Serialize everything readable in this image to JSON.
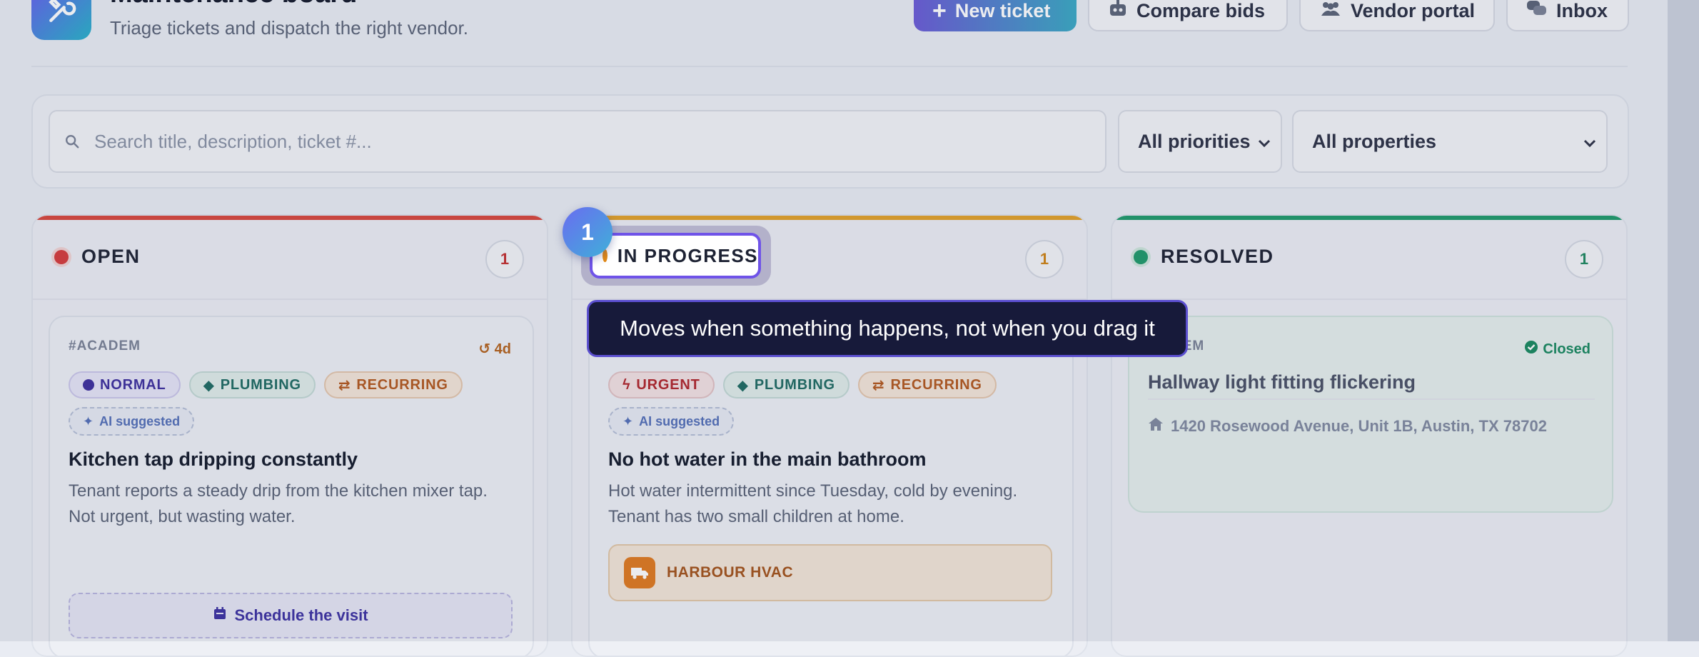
{
  "header": {
    "title": "Maintenance board",
    "subtitle": "Triage tickets and dispatch the right vendor.",
    "buttons": {
      "new_ticket": "New ticket",
      "compare_bids": "Compare bids",
      "vendor_portal": "Vendor portal",
      "inbox": "Inbox"
    }
  },
  "filters": {
    "search_placeholder": "Search title, description, ticket #...",
    "priority": "All priorities",
    "property": "All properties"
  },
  "columns": [
    {
      "title": "OPEN",
      "count": "1",
      "color": "#d63b3b",
      "card": {
        "id": "#ACADEM",
        "age": "4d",
        "tags": [
          "NORMAL",
          "PLUMBING",
          "RECURRING"
        ],
        "ai": "AI suggested",
        "title": "Kitchen tap dripping constantly",
        "description": "Tenant reports a steady drip from the kitchen mixer tap. Not urgent, but wasting water.",
        "action": "Schedule the visit"
      }
    },
    {
      "title": "IN PROGRESS",
      "count": "1",
      "color": "#e38a15",
      "card": {
        "tags": [
          "URGENT",
          "PLUMBING",
          "RECURRING"
        ],
        "ai": "AI suggested",
        "title": "No hot water in the main bathroom",
        "description": "Hot water intermittent since Tuesday, cold by evening. Tenant has two small children at home.",
        "vendor": "HARBOUR HVAC"
      }
    },
    {
      "title": "RESOLVED",
      "count": "1",
      "color": "#1f9a6a",
      "card": {
        "id_partial": "DEM",
        "status": "Closed",
        "title": "Hallway light fitting flickering",
        "address": "1420 Rosewood Avenue, Unit 1B, Austin, TX 78702"
      }
    }
  ],
  "tour": {
    "step": "1",
    "highlight_label": "IN PROGRESS",
    "tooltip": "Moves when something happens, not when you drag it"
  }
}
